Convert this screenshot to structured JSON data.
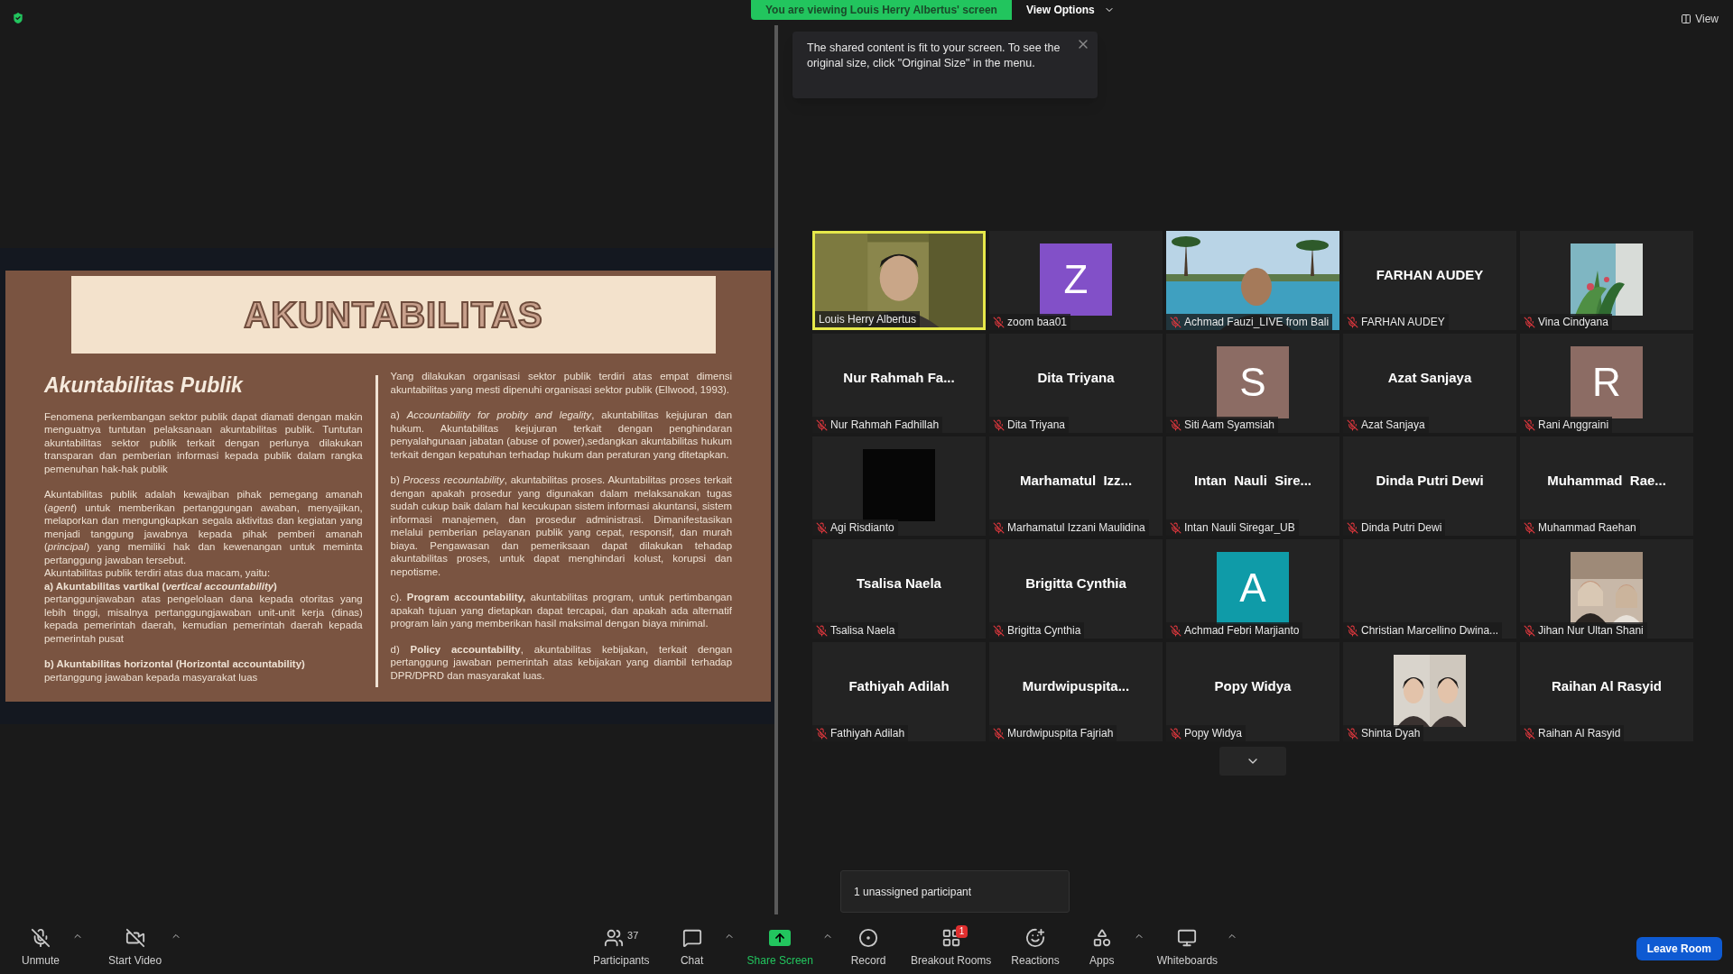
{
  "share_banner": {
    "text": "You are viewing Louis Herry Albertus' screen",
    "view_options": "View Options"
  },
  "notice": {
    "text": "The shared content is fit to your screen. To see the original size, click \"Original Size\" in the menu."
  },
  "view_button": "View",
  "slide": {
    "title": "AKUNTABILITAS",
    "heading": "Akuntabilitas Publik",
    "left_blocks": [
      {
        "items": [
          {
            "kind": "text",
            "text": "Fenomena perkembangan sektor publik dapat diamati dengan makin menguatnya tuntutan pelaksanaan akuntabilitas publik. Tuntutan akuntabilitas sektor publik terkait dengan perlunya dilakukan transparan dan pemberian informasi kepada publik dalam rangka pemenuhan hak-hak publik"
          }
        ]
      },
      {
        "items": [
          {
            "kind": "text",
            "text": "Akuntabilitas publik adalah kewajiban pihak pemegang amanah (*agent*) untuk memberikan pertanggungan awaban, menyajikan, melaporkan dan mengungkapkan segala aktivitas dan kegiatan yang menjadi tanggung jawabnya kepada pihak pemberi amanah (*principal*) yang memiliki hak dan kewenangan untuk meminta pertanggung jawaban tersebut."
          },
          {
            "kind": "text",
            "text": "Akuntabilitas publik terdiri atas dua macam, yaitu:"
          },
          {
            "kind": "heading",
            "text": "a) Akuntabilitas vartikal (*vertical accountability*)"
          },
          {
            "kind": "text",
            "text": "pertanggunjawaban atas pengelolaan dana kepada otoritas yang lebih tinggi, misalnya pertanggungjawaban unit-unit kerja (dinas) kepada pemerintah daerah, kemudian pemerintah daerah kepada pemerintah pusat"
          }
        ]
      },
      {
        "items": [
          {
            "kind": "heading",
            "text": "b) Akuntabilitas horizontal (Horizontal accountability)"
          },
          {
            "kind": "text",
            "text": "pertanggung jawaban kepada masyarakat luas"
          }
        ]
      }
    ],
    "right_paragraphs": [
      "Yang dilakukan organisasi sektor publik terdiri atas empat dimensi akuntabilitas yang mesti dipenuhi organisasi sektor publik (Ellwood, 1993).",
      "a) *Accountability for probity and legality*, akuntabilitas kejujuran dan hukum. Akuntabilitas kejujuran terkait dengan penghindaran penyalahgunaan jabatan (abuse of power),sedangkan akuntabilitas hukum terkait dengan kepatuhan terhadap hukum dan peraturan yang ditetapkan.",
      "b) *Process recountability*, akuntabilitas proses. Akuntabilitas proses terkait dengan apakah prosedur yang digunakan dalam melaksanakan tugas sudah cukup baik dalam hal kecukupan sistem informasi akuntansi, sistem informasi manajemen, dan prosedur administrasi. Dimanifestasikan melalui pemberian pelayanan publik yang cepat, responsif, dan murah biaya. Pengawasan dan pemeriksaan dapat dilakukan tehadap akuntabilitas proses, untuk dapat menghindari kolust, korupsi dan nepotisme.",
      "c). **Program accountability,** akuntabilitas program, untuk pertimbangan apakah tujuan yang dietapkan dapat tercapai, dan apakah ada alternatif program lain yang memberikan hasil maksimal dengan biaya minimal.",
      "d) **Policy accountability**, akuntabilitas kebijakan, terkait dengan pertanggung jawaban pemerintah atas kebijakan yang diambil terhadap DPR/DPRD dan masyarakat luas."
    ]
  },
  "participants": [
    {
      "name": "Louis Herry Albertus",
      "kind": "video",
      "muted": false,
      "speaking": true
    },
    {
      "name": "zoom baa01",
      "kind": "letter",
      "letter": "Z",
      "color": "#8250c8",
      "muted": true,
      "speaking": false
    },
    {
      "name": "Achmad Fauzi_LIVE from Bali",
      "kind": "video",
      "muted": true,
      "speaking": false
    },
    {
      "name": "FARHAN AUDEY",
      "kind": "name",
      "display": "FARHAN AUDEY",
      "muted": true,
      "speaking": false
    },
    {
      "name": "Vina Cindyana",
      "muted": true,
      "speaking": false
    },
    {
      "name": "Nur Rahmah Fadhillah",
      "kind": "name",
      "display": "Nur Rahmah Fa...",
      "muted": true,
      "speaking": false
    },
    {
      "name": "Dita Triyana",
      "kind": "name",
      "display": "Dita Triyana",
      "muted": true,
      "speaking": false
    },
    {
      "name": "Siti Aam Syamsiah",
      "kind": "letter",
      "letter": "S",
      "color": "#8c6c64",
      "muted": true,
      "speaking": false
    },
    {
      "name": "Azat Sanjaya",
      "kind": "name",
      "display": "Azat Sanjaya",
      "muted": true,
      "speaking": false
    },
    {
      "name": "Rani Anggraini",
      "kind": "letter",
      "letter": "R",
      "color": "#8c6c64",
      "muted": true,
      "speaking": false
    },
    {
      "name": "Agi Risdianto",
      "kind": "dark",
      "muted": true,
      "speaking": false
    },
    {
      "name": "Marhamatul Izzani Maulidina",
      "kind": "name",
      "display": "Marhamatul  Izz...",
      "muted": true,
      "speaking": false
    },
    {
      "name": "Intan Nauli Siregar_UB",
      "kind": "name",
      "display": "Intan  Nauli  Sire...",
      "muted": true,
      "speaking": false
    },
    {
      "name": "Dinda Putri Dewi",
      "kind": "name",
      "display": "Dinda Putri Dewi",
      "muted": true,
      "speaking": false
    },
    {
      "name": "Muhammad Raehan",
      "kind": "name",
      "display": "Muhammad  Rae...",
      "muted": true,
      "speaking": false
    },
    {
      "name": "Tsalisa Naela",
      "kind": "name",
      "display": "Tsalisa Naela",
      "muted": true,
      "speaking": false
    },
    {
      "name": "Brigitta Cynthia",
      "kind": "name",
      "display": "Brigitta Cynthia",
      "muted": true,
      "speaking": false
    },
    {
      "name": "Achmad Febri Marjianto",
      "kind": "letter",
      "letter": "A",
      "color": "#0f9ba8",
      "muted": true,
      "speaking": false
    },
    {
      "name": "Christian Marcellino Dwina...",
      "kind": "blank",
      "muted": true,
      "speaking": false
    },
    {
      "name": "Jihan Nur Ultan Shani",
      "muted": true,
      "speaking": false
    },
    {
      "name": "Fathiyah Adilah",
      "kind": "name",
      "display": "Fathiyah Adilah",
      "muted": true,
      "speaking": false
    },
    {
      "name": "Murdwipuspita Fajriah",
      "kind": "name",
      "display": "Murdwipuspita...",
      "muted": true,
      "speaking": false
    },
    {
      "name": "Popy Widya",
      "kind": "name",
      "display": "Popy Widya",
      "muted": true,
      "speaking": false
    },
    {
      "name": "Shinta Dyah",
      "muted": true,
      "speaking": false
    },
    {
      "name": "Raihan Al Rasyid",
      "kind": "name",
      "display": "Raihan Al Rasyid",
      "muted": true,
      "speaking": false
    }
  ],
  "unassigned_notice": "1 unassigned participant",
  "toolbar": {
    "left": [
      {
        "kind": "mic",
        "label": "Unmute",
        "menu": true
      },
      {
        "kind": "video",
        "label": "Start Video",
        "menu": true
      }
    ],
    "center": [
      {
        "kind": "participants",
        "label": "Participants",
        "count": "37",
        "menu": false
      },
      {
        "kind": "chat",
        "label": "Chat",
        "menu": true
      },
      {
        "kind": "share",
        "label": "Share Screen",
        "menu": true
      },
      {
        "kind": "record",
        "label": "Record",
        "menu": false
      },
      {
        "kind": "breakout",
        "label": "Breakout Rooms",
        "badge": "1",
        "menu": false
      },
      {
        "kind": "reactions",
        "label": "Reactions",
        "menu": false
      },
      {
        "kind": "apps",
        "label": "Apps",
        "menu": true
      },
      {
        "kind": "whiteboard",
        "label": "Whiteboards",
        "menu": true
      }
    ],
    "leave": "Leave Room"
  }
}
